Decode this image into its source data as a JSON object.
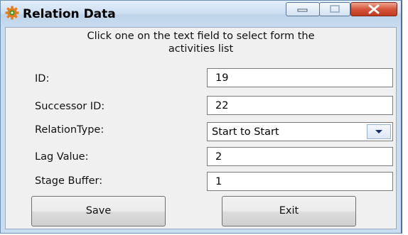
{
  "window": {
    "title": "Relation Data",
    "controls": [
      "minimize-icon",
      "maximize-icon",
      "close-icon"
    ]
  },
  "instructions": [
    "Click one on the text field to select form the",
    "activities list"
  ],
  "form": {
    "id": {
      "label": "ID:",
      "value": "19"
    },
    "successor_id": {
      "label": "Successor ID:",
      "value": "22"
    },
    "relation_type": {
      "label": "RelationType:",
      "selected": "Start to Start"
    },
    "lag_value": {
      "label": "Lag Value:",
      "value": "2"
    },
    "stage_buffer": {
      "label": "Stage Buffer:",
      "value": "1"
    }
  },
  "buttons": {
    "save": "Save",
    "exit": "Exit"
  },
  "colors": {
    "close_button": "#c9452a",
    "window_frame": "#c9ddf0",
    "dialog_body": "#f0f0f0",
    "icon_orange": "#e87a1a",
    "icon_green": "#3c9a2e"
  }
}
